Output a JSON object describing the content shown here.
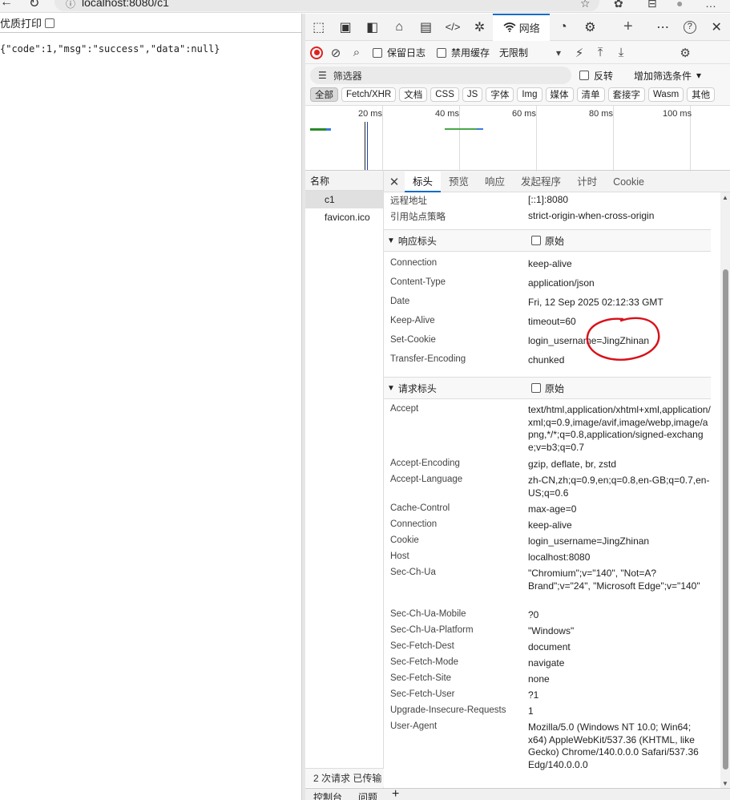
{
  "browser": {
    "url": "localhost:8080/c1",
    "nav_back": "←",
    "nav_reload": "↻",
    "info_icon": "ⓘ",
    "star_icon": "☆",
    "extensions_icon": "✿",
    "collections_icon": "⊟",
    "profile_icon": "●",
    "menu_icon": "…"
  },
  "page": {
    "print_label": "优质打印",
    "response_text": "{\"code\":1,\"msg\":\"success\",\"data\":null}"
  },
  "devtools": {
    "tabs": {
      "inspect": "⬚",
      "device": "▣",
      "panel": "◧",
      "welcome": "⌂",
      "console": "▤",
      "elements": "</>",
      "sources": "✲",
      "network": "网络",
      "performance": "◔",
      "settings_tab": "⚙",
      "plus": "+",
      "more": "⋯",
      "help": "?",
      "close": "✕"
    },
    "toolbar": {
      "preserve_log": "保留日志",
      "disable_cache": "禁用缓存",
      "throttle": "无限制",
      "throttle_arrow": "▾",
      "wifi": "⚡",
      "upload": "⤒",
      "download": "⤓",
      "gear": "⚙",
      "clear": "⊘",
      "search": "⌕"
    },
    "filter": {
      "placeholder": "筛选器",
      "invert": "反转",
      "more_filters": "增加筛选条件",
      "dropdown": "▾"
    },
    "types": [
      "全部",
      "Fetch/XHR",
      "文档",
      "CSS",
      "JS",
      "字体",
      "Img",
      "媒体",
      "清单",
      "套接字",
      "Wasm",
      "其他"
    ],
    "timeline": {
      "ticks": [
        "20 ms",
        "40 ms",
        "60 ms",
        "80 ms",
        "100 ms"
      ]
    },
    "requests": {
      "header": "名称",
      "items": [
        "c1",
        "favicon.ico"
      ],
      "status": "2 次请求  已传输"
    },
    "details": {
      "tabs": [
        "标头",
        "预览",
        "响应",
        "发起程序",
        "计时",
        "Cookie"
      ],
      "general": [
        {
          "k": "远程地址",
          "v": "[::1]:8080"
        },
        {
          "k": "引用站点策略",
          "v": "strict-origin-when-cross-origin"
        }
      ],
      "response_section": "响应标头",
      "raw_label": "原始",
      "response_headers": [
        {
          "k": "Connection",
          "v": "keep-alive"
        },
        {
          "k": "Content-Type",
          "v": "application/json"
        },
        {
          "k": "Date",
          "v": "Fri, 12 Sep 2025 02:12:33 GMT"
        },
        {
          "k": "Keep-Alive",
          "v": "timeout=60"
        },
        {
          "k": "Set-Cookie",
          "v": "login_username=JingZhinan"
        },
        {
          "k": "Transfer-Encoding",
          "v": "chunked"
        }
      ],
      "request_section": "请求标头",
      "request_headers": [
        {
          "k": "Accept",
          "v": "text/html,application/xhtml+xml,application/xml;q=0.9,image/avif,image/webp,image/apng,*/*;q=0.8,application/signed-exchange;v=b3;q=0.7"
        },
        {
          "k": "Accept-Encoding",
          "v": "gzip, deflate, br, zstd"
        },
        {
          "k": "Accept-Language",
          "v": "zh-CN,zh;q=0.9,en;q=0.8,en-GB;q=0.7,en-US;q=0.6"
        },
        {
          "k": "Cache-Control",
          "v": "max-age=0"
        },
        {
          "k": "Connection",
          "v": "keep-alive"
        },
        {
          "k": "Cookie",
          "v": "login_username=JingZhinan"
        },
        {
          "k": "Host",
          "v": "localhost:8080"
        },
        {
          "k": "Sec-Ch-Ua",
          "v": "\"Chromium\";v=\"140\", \"Not=A?Brand\";v=\"24\", \"Microsoft Edge\";v=\"140\""
        },
        {
          "k": "Sec-Ch-Ua-Mobile",
          "v": "?0"
        },
        {
          "k": "Sec-Ch-Ua-Platform",
          "v": "\"Windows\""
        },
        {
          "k": "Sec-Fetch-Dest",
          "v": "document"
        },
        {
          "k": "Sec-Fetch-Mode",
          "v": "navigate"
        },
        {
          "k": "Sec-Fetch-Site",
          "v": "none"
        },
        {
          "k": "Sec-Fetch-User",
          "v": "?1"
        },
        {
          "k": "Upgrade-Insecure-Requests",
          "v": "1"
        },
        {
          "k": "User-Agent",
          "v": "Mozilla/5.0 (Windows NT 10.0; Win64; x64) AppleWebKit/537.36 (KHTML, like Gecko) Chrome/140.0.0.0 Safari/537.36 Edg/140.0.0.0"
        }
      ]
    },
    "bottom": {
      "console": "控制台",
      "issues": "问题",
      "plus": "+"
    }
  },
  "colors": {
    "accent": "#0b6bcb",
    "annotation": "#d8101a",
    "record": "#dd2222"
  }
}
